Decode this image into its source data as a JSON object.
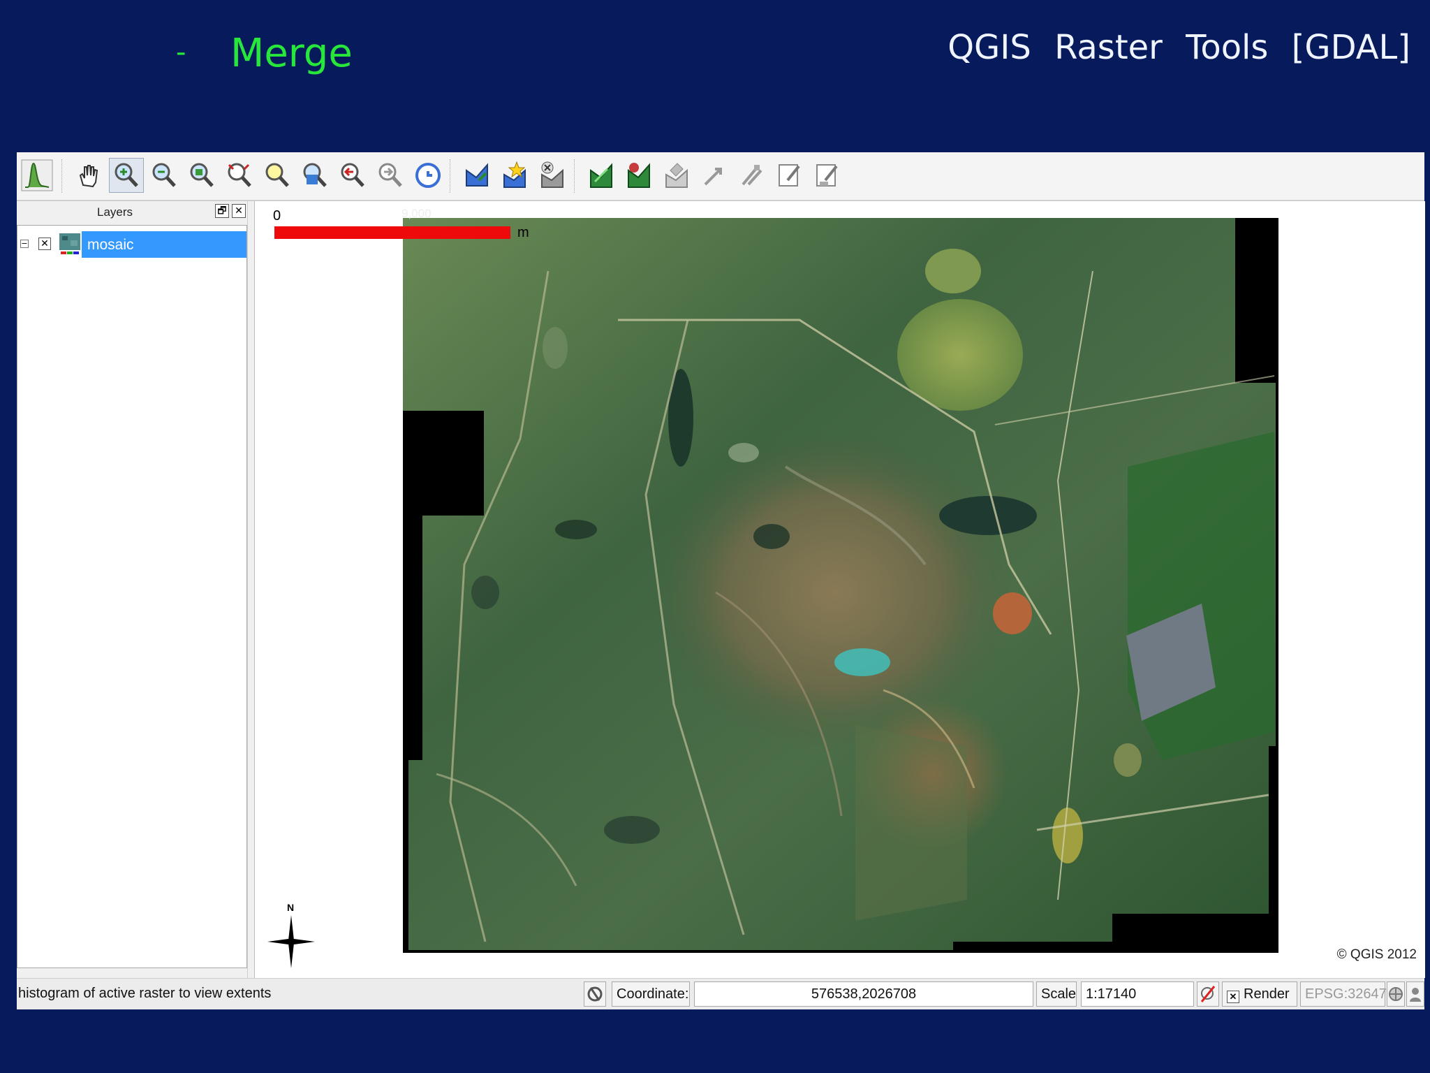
{
  "slide": {
    "dash": "-",
    "title": "Merge",
    "topic": "QGIS Raster Tools [GDAL]"
  },
  "toolbar": {
    "icons": [
      "histogram-stretch-icon",
      "pan-icon",
      "zoom-in-icon",
      "zoom-out-icon",
      "zoom-full-icon",
      "zoom-layer-icon",
      "zoom-selection-icon",
      "zoom-native-icon",
      "zoom-last-icon",
      "zoom-next-icon",
      "refresh-icon",
      "add-vector-icon",
      "new-bookmark-icon",
      "remove-layer-icon",
      "add-raster-icon",
      "add-wms-icon",
      "digitize-icon",
      "move-feature-icon",
      "node-tool-icon",
      "toggle-edit-icon",
      "save-edits-icon"
    ],
    "active": "zoom-in-icon"
  },
  "layers_panel": {
    "title": "Layers",
    "float_glyph": "🗗",
    "close_glyph": "✕",
    "items": [
      {
        "name": "mosaic",
        "checked": true,
        "expanded": true,
        "selected": true
      }
    ]
  },
  "map": {
    "scalebar": {
      "zero": "0",
      "end": "9,000",
      "unit": "m"
    },
    "north_label": "N",
    "copyright": "© QGIS 2012"
  },
  "statusbar": {
    "message": "histogram of active raster to view extents",
    "coordinate_label": "Coordinate:",
    "coordinate_value": "576538,2026708",
    "scale_label": "Scale",
    "scale_value": "1:17140",
    "render_label": "Render",
    "render_checked": true,
    "crs": "EPSG:32647"
  },
  "colors": {
    "slide_background": "#061a5c",
    "title_green": "#27e83a",
    "selection_blue": "#3399ff",
    "scalebar_red": "#ee0a0a"
  }
}
